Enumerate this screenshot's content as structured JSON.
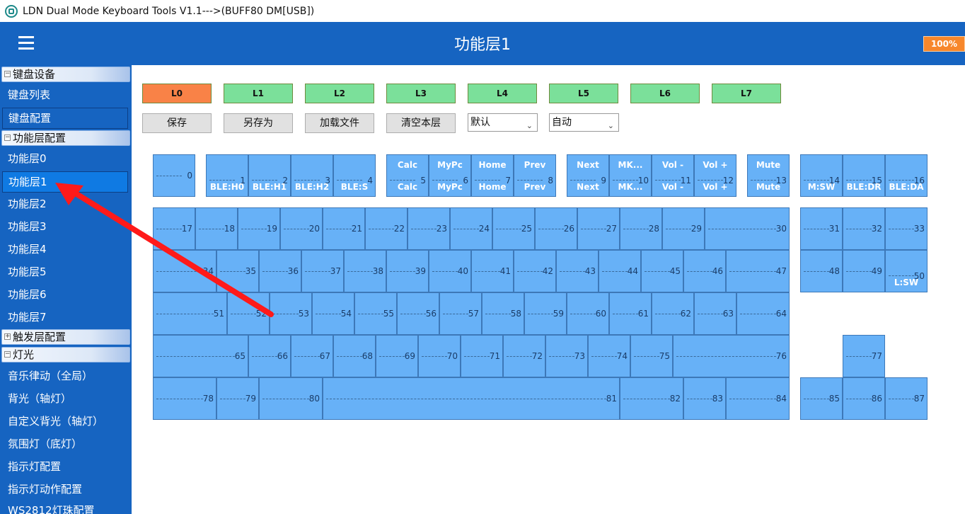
{
  "window": {
    "title": "LDN Dual Mode Keyboard Tools V1.1--->(BUFF80 DM[USB])"
  },
  "header": {
    "title": "功能层1",
    "battery": "100%"
  },
  "sidebar": {
    "groups": [
      {
        "label": "键盘设备",
        "toggle": "−"
      },
      {
        "label": "功能层配置",
        "toggle": "−"
      },
      {
        "label": "触发层配置",
        "toggle": "+"
      },
      {
        "label": "灯光",
        "toggle": "−"
      }
    ],
    "device_items": [
      "键盘列表",
      "键盘配置"
    ],
    "layer_items": [
      "功能层0",
      "功能层1",
      "功能层2",
      "功能层3",
      "功能层4",
      "功能层5",
      "功能层6",
      "功能层7"
    ],
    "light_items": [
      "音乐律动（全局）",
      "背光（轴灯）",
      "自定义背光（轴灯）",
      "氛围灯（底灯）",
      "指示灯配置",
      "指示灯动作配置",
      "WS2812灯珠配置"
    ],
    "active_item": "功能层1"
  },
  "layers": [
    "L0",
    "L1",
    "L2",
    "L3",
    "L4",
    "L5",
    "L6",
    "L7"
  ],
  "active_layer": "L0",
  "actions": {
    "save": "保存",
    "save_as": "另存为",
    "load_file": "加载文件",
    "clear_layer": "清空本层"
  },
  "selects": {
    "mode1": "默认",
    "mode2": "自动"
  },
  "keys": [
    {
      "n": "0"
    },
    {
      "n": "1",
      "top": "",
      "bot": "BLE:H0"
    },
    {
      "n": "2",
      "top": "",
      "bot": "BLE:H1"
    },
    {
      "n": "3",
      "top": "",
      "bot": "BLE:H2"
    },
    {
      "n": "4",
      "top": "",
      "bot": "BLE:S"
    },
    {
      "n": "5",
      "top": "Calc",
      "bot": "Calc"
    },
    {
      "n": "6",
      "top": "MyPc",
      "bot": "MyPc"
    },
    {
      "n": "7",
      "top": "Home",
      "bot": "Home"
    },
    {
      "n": "8",
      "top": "Prev",
      "bot": "Prev"
    },
    {
      "n": "9",
      "top": "Next",
      "bot": "Next"
    },
    {
      "n": "10",
      "top": "MK...",
      "bot": "MK..."
    },
    {
      "n": "11",
      "top": "Vol -",
      "bot": "Vol -"
    },
    {
      "n": "12",
      "top": "Vol +",
      "bot": "Vol +"
    },
    {
      "n": "13",
      "top": "Mute",
      "bot": "Mute"
    },
    {
      "n": "14",
      "top": "",
      "bot": "M:SW"
    },
    {
      "n": "15",
      "top": "",
      "bot": "BLE:DR"
    },
    {
      "n": "16",
      "top": "",
      "bot": "BLE:DA"
    },
    {
      "n": "17"
    },
    {
      "n": "18"
    },
    {
      "n": "19"
    },
    {
      "n": "20"
    },
    {
      "n": "21"
    },
    {
      "n": "22"
    },
    {
      "n": "23"
    },
    {
      "n": "24"
    },
    {
      "n": "25"
    },
    {
      "n": "26"
    },
    {
      "n": "27"
    },
    {
      "n": "28"
    },
    {
      "n": "29"
    },
    {
      "n": "30"
    },
    {
      "n": "31"
    },
    {
      "n": "32"
    },
    {
      "n": "33"
    },
    {
      "n": "34"
    },
    {
      "n": "35"
    },
    {
      "n": "36"
    },
    {
      "n": "37"
    },
    {
      "n": "38"
    },
    {
      "n": "39"
    },
    {
      "n": "40"
    },
    {
      "n": "41"
    },
    {
      "n": "42"
    },
    {
      "n": "43"
    },
    {
      "n": "44"
    },
    {
      "n": "45"
    },
    {
      "n": "46"
    },
    {
      "n": "47"
    },
    {
      "n": "48"
    },
    {
      "n": "49"
    },
    {
      "n": "50",
      "top": "",
      "bot": "L:SW"
    },
    {
      "n": "51"
    },
    {
      "n": "52"
    },
    {
      "n": "53"
    },
    {
      "n": "54"
    },
    {
      "n": "55"
    },
    {
      "n": "56"
    },
    {
      "n": "57"
    },
    {
      "n": "58"
    },
    {
      "n": "59"
    },
    {
      "n": "60"
    },
    {
      "n": "61"
    },
    {
      "n": "62"
    },
    {
      "n": "63"
    },
    {
      "n": "64"
    },
    {
      "n": "65"
    },
    {
      "n": "66"
    },
    {
      "n": "67"
    },
    {
      "n": "68"
    },
    {
      "n": "69"
    },
    {
      "n": "70"
    },
    {
      "n": "71"
    },
    {
      "n": "72"
    },
    {
      "n": "73"
    },
    {
      "n": "74"
    },
    {
      "n": "75"
    },
    {
      "n": "76"
    },
    {
      "n": "77"
    },
    {
      "n": "78"
    },
    {
      "n": "79"
    },
    {
      "n": "80"
    },
    {
      "n": "81"
    },
    {
      "n": "82"
    },
    {
      "n": "83"
    },
    {
      "n": "84"
    },
    {
      "n": "85"
    },
    {
      "n": "86"
    },
    {
      "n": "87"
    }
  ],
  "colors": {
    "header": "#1664c1",
    "key": "#67b1f7",
    "layer_active": "#f98247",
    "layer": "#7be09a",
    "arrow": "#ff1a1a"
  }
}
